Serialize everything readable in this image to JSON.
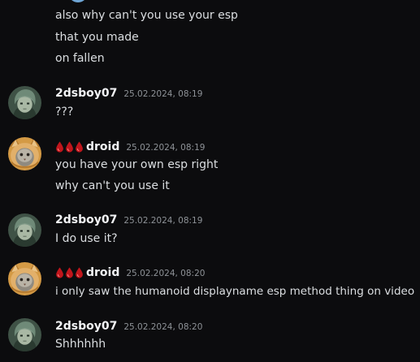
{
  "messages": [
    {
      "continuation": true,
      "lines": [
        "also why can't you use your esp",
        "that you made",
        "on fallen"
      ]
    },
    {
      "author": "2dsboy07",
      "timestamp": "25.02.2024, 08:19",
      "avatar_icon": "cartoon-character-avatar",
      "lines": [
        "???"
      ]
    },
    {
      "author": "droid",
      "author_prefix_icons": [
        "blood-drop-icon",
        "blood-drop-icon",
        "blood-drop-icon"
      ],
      "timestamp": "25.02.2024, 08:19",
      "avatar_icon": "cat-avatar",
      "lines": [
        "you have your own esp right",
        "why can't you use it"
      ]
    },
    {
      "author": "2dsboy07",
      "timestamp": "25.02.2024, 08:19",
      "avatar_icon": "cartoon-character-avatar",
      "lines": [
        "I do use it?"
      ]
    },
    {
      "author": "droid",
      "author_prefix_icons": [
        "blood-drop-icon",
        "blood-drop-icon",
        "blood-drop-icon"
      ],
      "timestamp": "25.02.2024, 08:20",
      "avatar_icon": "cat-avatar",
      "lines": [
        "i only saw the humanoid displayname esp method thing on video"
      ]
    },
    {
      "author": "2dsboy07",
      "timestamp": "25.02.2024, 08:20",
      "avatar_icon": "cartoon-character-avatar",
      "lines": [
        "Shhhhhh"
      ]
    }
  ],
  "colors": {
    "background": "#0c0c0e",
    "message_text": "#dbdee1",
    "username": "#f2f3f5",
    "timestamp": "#8e9297",
    "blood_drop": "#c0161c"
  }
}
